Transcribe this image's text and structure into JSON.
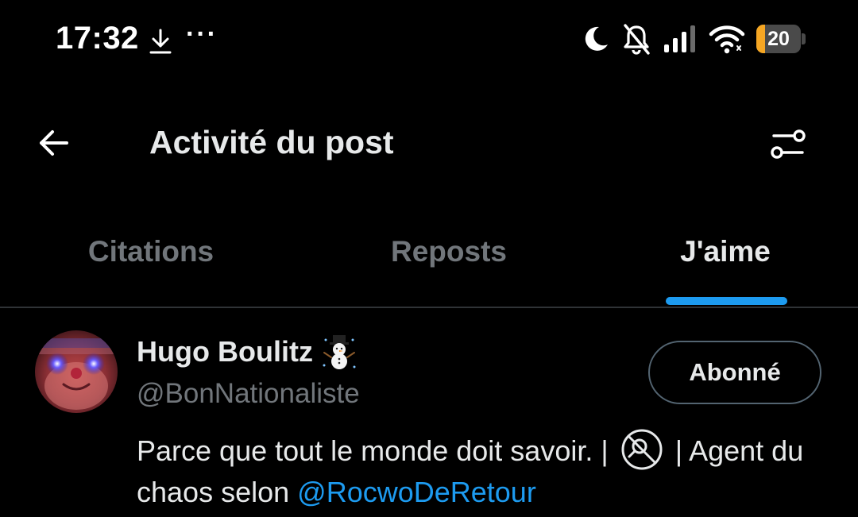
{
  "status_bar": {
    "time": "17:32",
    "more_indicator": "···",
    "battery_level": "20",
    "battery_fill_fraction": 0.2,
    "battery_color": "#f5a623",
    "icons": [
      "download-icon",
      "moon-icon",
      "bell-off-icon",
      "signal-icon",
      "wifi-icon",
      "battery-icon"
    ]
  },
  "header": {
    "title": "Activité du post",
    "back_icon": "arrow-left-icon",
    "filter_icon": "sliders-icon"
  },
  "tabs": [
    {
      "label": "Citations",
      "active": false
    },
    {
      "label": "Reposts",
      "active": false
    },
    {
      "label": "J'aime",
      "active": true
    }
  ],
  "user": {
    "display_name": "Hugo Boulitz",
    "name_emoji": "snowman-icon",
    "handle": "@BonNationaliste",
    "follow_label": "Abonné",
    "bio": {
      "part1": "Parce que tout le monde doit savoir. |",
      "symbol": "no-magnifier-icon",
      "part2": "| Agent du chaos selon",
      "mention": "@RocwoDeRetour"
    }
  },
  "colors": {
    "background": "#000000",
    "text": "#e7e9ea",
    "secondary_text": "#71767b",
    "accent": "#1d9bf0",
    "divider": "#2f3336"
  }
}
